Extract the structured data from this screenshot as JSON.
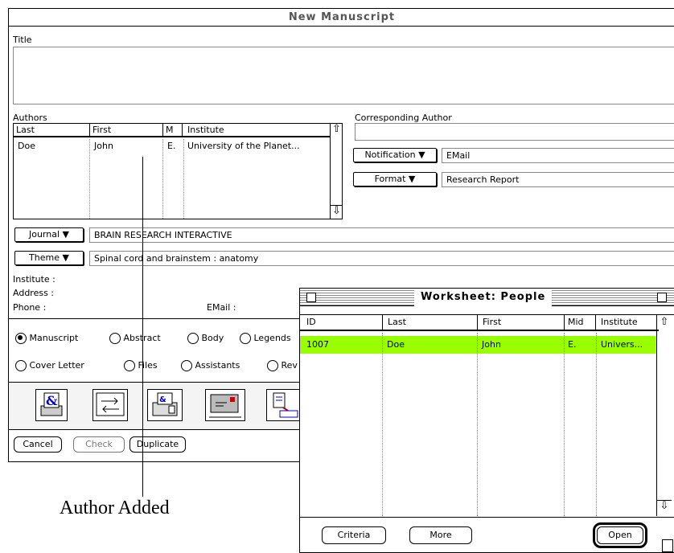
{
  "manuscript_window": {
    "title": "New Manuscript",
    "title_label": "Title",
    "authors_label": "Authors",
    "author_columns": [
      "Last",
      "First",
      "M",
      "Institute"
    ],
    "author_rows": [
      {
        "last": "Doe",
        "first": "John",
        "m": "E.",
        "institute": "University of the Planet..."
      }
    ],
    "corresponding_author_label": "Corresponding Author",
    "notification": {
      "label": "Notification",
      "value": "EMail"
    },
    "format": {
      "label": "Format",
      "value": "Research Report"
    },
    "journal": {
      "label": "Journal",
      "value": "BRAIN RESEARCH INTERACTIVE"
    },
    "theme": {
      "label": "Theme",
      "value": "Spinal cord and brainstem : anatomy"
    },
    "institute_label": "Institute :",
    "address_label": "Address :",
    "phone_label": "Phone :",
    "email_label": "EMail :",
    "radios_row1": [
      "Manuscript",
      "Abstract",
      "Body",
      "Legends"
    ],
    "radios_row2": [
      "Cover Letter",
      "Files",
      "Assistants",
      "Rev"
    ],
    "selected_radio": "Manuscript",
    "buttons": {
      "cancel": "Cancel",
      "check": "Check",
      "duplicate": "Duplicate"
    }
  },
  "worksheet_window": {
    "title": "Worksheet: People",
    "columns": [
      "ID",
      "Last",
      "First",
      "Mid",
      "Institute"
    ],
    "rows": [
      {
        "id": "1007",
        "last": "Doe",
        "first": "John",
        "mid": "E.",
        "institute": "Univers..."
      }
    ],
    "highlight_color": "#99ff00",
    "buttons": {
      "criteria": "Criteria",
      "more": "More",
      "open": "Open"
    }
  },
  "annotation": {
    "text": "Author Added"
  }
}
